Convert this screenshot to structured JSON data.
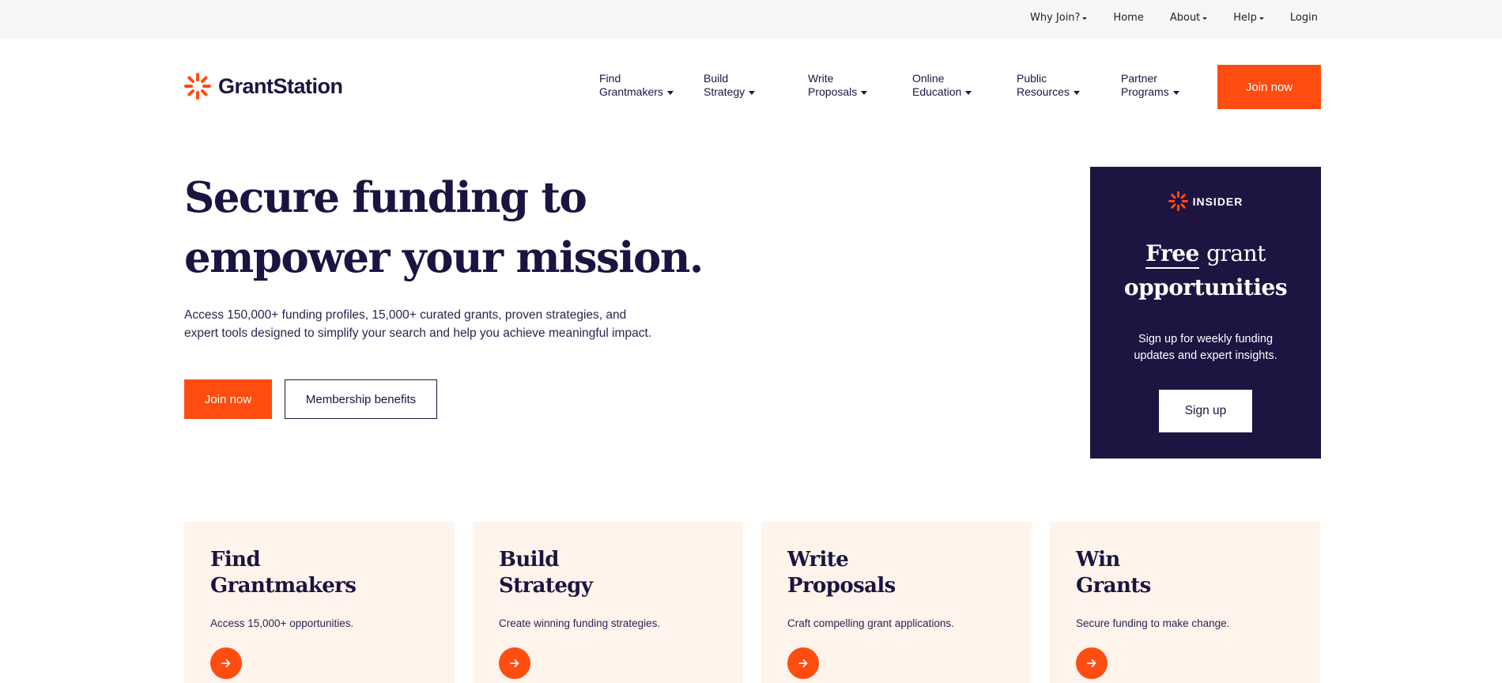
{
  "utility_nav": {
    "items": [
      {
        "label": "Why Join?",
        "dropdown": true
      },
      {
        "label": "Home",
        "dropdown": false
      },
      {
        "label": "About",
        "dropdown": true
      },
      {
        "label": "Help",
        "dropdown": true
      },
      {
        "label": "Login",
        "dropdown": false
      }
    ]
  },
  "brand": {
    "name": "GrantStation",
    "logo_icon": "sunburst-icon",
    "accent_color": "#ff4c10",
    "navy_color": "#1c1440"
  },
  "main_nav": {
    "items": [
      {
        "line1": "Find",
        "line2": "Grantmakers"
      },
      {
        "line1": "Build",
        "line2": "Strategy"
      },
      {
        "line1": "Write",
        "line2": "Proposals"
      },
      {
        "line1": "Online",
        "line2": "Education"
      },
      {
        "line1": "Public",
        "line2": "Resources"
      },
      {
        "line1": "Partner",
        "line2": "Programs"
      }
    ],
    "join_label": "Join now"
  },
  "hero": {
    "title_line1": "Secure funding to",
    "title_line2": "empower your mission.",
    "description": "Access 150,000+ funding profiles, 15,000+ curated grants, proven strategies, and expert tools designed to simplify your search and help you achieve meaningful impact.",
    "primary_label": "Join now",
    "secondary_label": "Membership benefits"
  },
  "insider": {
    "label": "INSIDER",
    "title_underlined": "Free",
    "title_rest": "grant",
    "title_line2": "opportunities",
    "description": "Sign up for weekly funding updates and expert insights.",
    "button_label": "Sign up",
    "background_color": "#1d1442"
  },
  "features": [
    {
      "title_line1": "Find",
      "title_line2": "Grantmakers",
      "description": "Access 15,000+ opportunities.",
      "icon": "arrow-right-icon"
    },
    {
      "title_line1": "Build",
      "title_line2": "Strategy",
      "description": "Create winning funding strategies.",
      "icon": "arrow-right-icon"
    },
    {
      "title_line1": "Write",
      "title_line2": "Proposals",
      "description": "Craft compelling grant applications.",
      "icon": "arrow-right-icon"
    },
    {
      "title_line1": "Win",
      "title_line2": "Grants",
      "description": "Secure funding to make change.",
      "icon": "arrow-right-icon"
    }
  ]
}
